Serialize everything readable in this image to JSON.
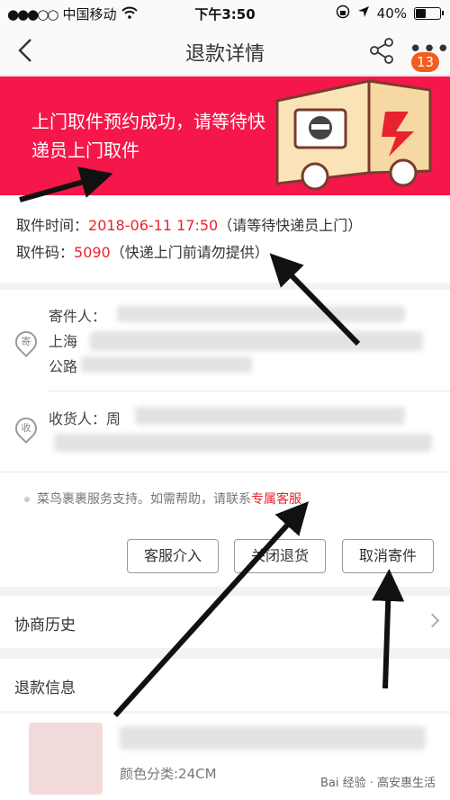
{
  "status_bar": {
    "carrier": "中国移动",
    "time": "下午3:50",
    "battery": "40%"
  },
  "nav": {
    "title": "退款详情",
    "badge": "13"
  },
  "banner": {
    "message": "上门取件预约成功，请等待快递员上门取件"
  },
  "pickup": {
    "time_label": "取件时间：",
    "time_value": "2018-06-11 17:50",
    "time_note": "（请等待快递员上门）",
    "code_label": "取件码：",
    "code_value": "5090",
    "code_note": "（快递上门前请勿提供）"
  },
  "sender": {
    "icon_char": "寄",
    "label": "寄件人：",
    "line2": "上海",
    "line3": "公路"
  },
  "receiver": {
    "icon_char": "收",
    "label": "收货人：周"
  },
  "service": {
    "note": "菜鸟裹裹服务支持。如需帮助，请联系",
    "link": "专属客服"
  },
  "actions": {
    "customer_service": "客服介入",
    "close_return": "关闭退货",
    "cancel_shipment": "取消寄件"
  },
  "history": {
    "label": "协商历史"
  },
  "refund_info": {
    "label": "退款信息"
  },
  "product": {
    "spec": "颜色分类:24CM"
  },
  "watermark": {
    "text": "Bai 经验 · 高安惠生活"
  },
  "colors": {
    "brand_red": "#f5174a",
    "highlight_red": "#e8232f",
    "badge_orange": "#f45c1e"
  }
}
